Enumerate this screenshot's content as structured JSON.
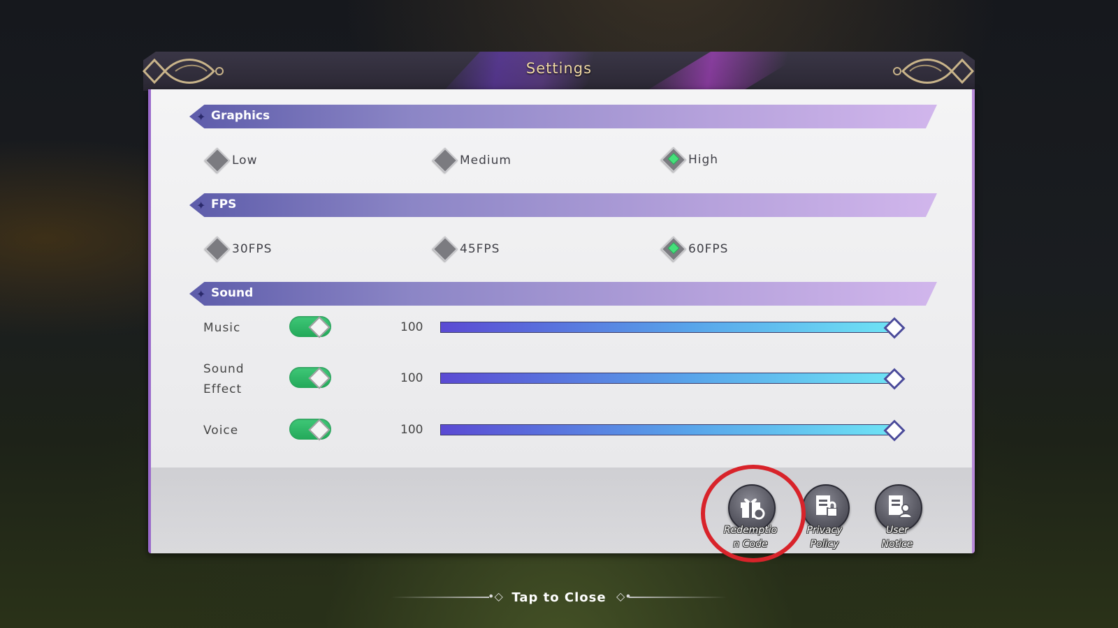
{
  "dialog": {
    "title": "Settings"
  },
  "graphics": {
    "header": "Graphics",
    "options": [
      {
        "label": "Low",
        "selected": false
      },
      {
        "label": "Medium",
        "selected": false
      },
      {
        "label": "High",
        "selected": true
      }
    ]
  },
  "fps": {
    "header": "FPS",
    "options": [
      {
        "label": "30FPS",
        "selected": false
      },
      {
        "label": "45FPS",
        "selected": false
      },
      {
        "label": "60FPS",
        "selected": true
      }
    ]
  },
  "sound": {
    "header": "Sound",
    "rows": [
      {
        "label": "Music",
        "enabled": true,
        "value": "100",
        "level": 1.0
      },
      {
        "label": "Sound\nEffect",
        "enabled": true,
        "value": "100",
        "level": 1.0
      },
      {
        "label": "Voice",
        "enabled": true,
        "value": "100",
        "level": 1.0
      }
    ]
  },
  "footer_buttons": [
    {
      "label": "Redemption Code",
      "label_line1": "Redemptio",
      "label_line2": "n Code",
      "icon": "gift-icon"
    },
    {
      "label": "Privacy Policy",
      "label_line1": "Privacy",
      "label_line2": "Policy",
      "icon": "document-lock-icon"
    },
    {
      "label": "User Notice",
      "label_line1": "User",
      "label_line2": "Notice",
      "icon": "document-user-icon"
    }
  ],
  "close_hint": "Tap to Close",
  "colors": {
    "accent_purple": "#8c86c6",
    "selected_green": "#45e07a",
    "toggle_green": "#23a859",
    "highlight_red": "#d8232a",
    "title_gold": "#f1d9a6"
  }
}
